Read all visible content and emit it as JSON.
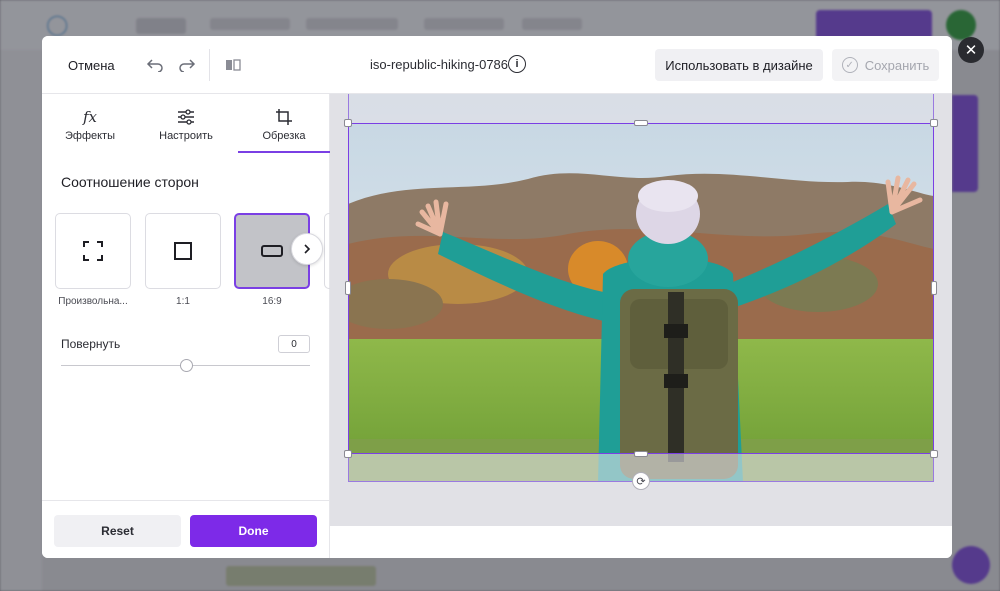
{
  "header": {
    "cancel_label": "Отмена",
    "file_title": "iso-republic-hiking-0786",
    "use_in_design_label": "Использовать в дизайне",
    "save_label": "Сохранить"
  },
  "tabs": [
    {
      "label": "Эффекты",
      "icon": "fx-icon"
    },
    {
      "label": "Настроить",
      "icon": "sliders-icon"
    },
    {
      "label": "Обрезка",
      "icon": "crop-icon",
      "active": true
    }
  ],
  "aspect_ratio": {
    "title": "Соотношение сторон",
    "options": [
      {
        "label": "Произвольна...",
        "icon": "freeform-icon"
      },
      {
        "label": "1:1",
        "icon": "square-icon"
      },
      {
        "label": "16:9",
        "icon": "widescreen-icon",
        "selected": true
      }
    ]
  },
  "rotate": {
    "label": "Повернуть",
    "value": "0",
    "slider_fraction": 0.5
  },
  "footer": {
    "reset_label": "Reset",
    "done_label": "Done"
  },
  "colors": {
    "accent": "#7d2ae8",
    "jacket": "#1f9e96",
    "backpack": "#6b6b45",
    "grass": "#7ab23c"
  }
}
